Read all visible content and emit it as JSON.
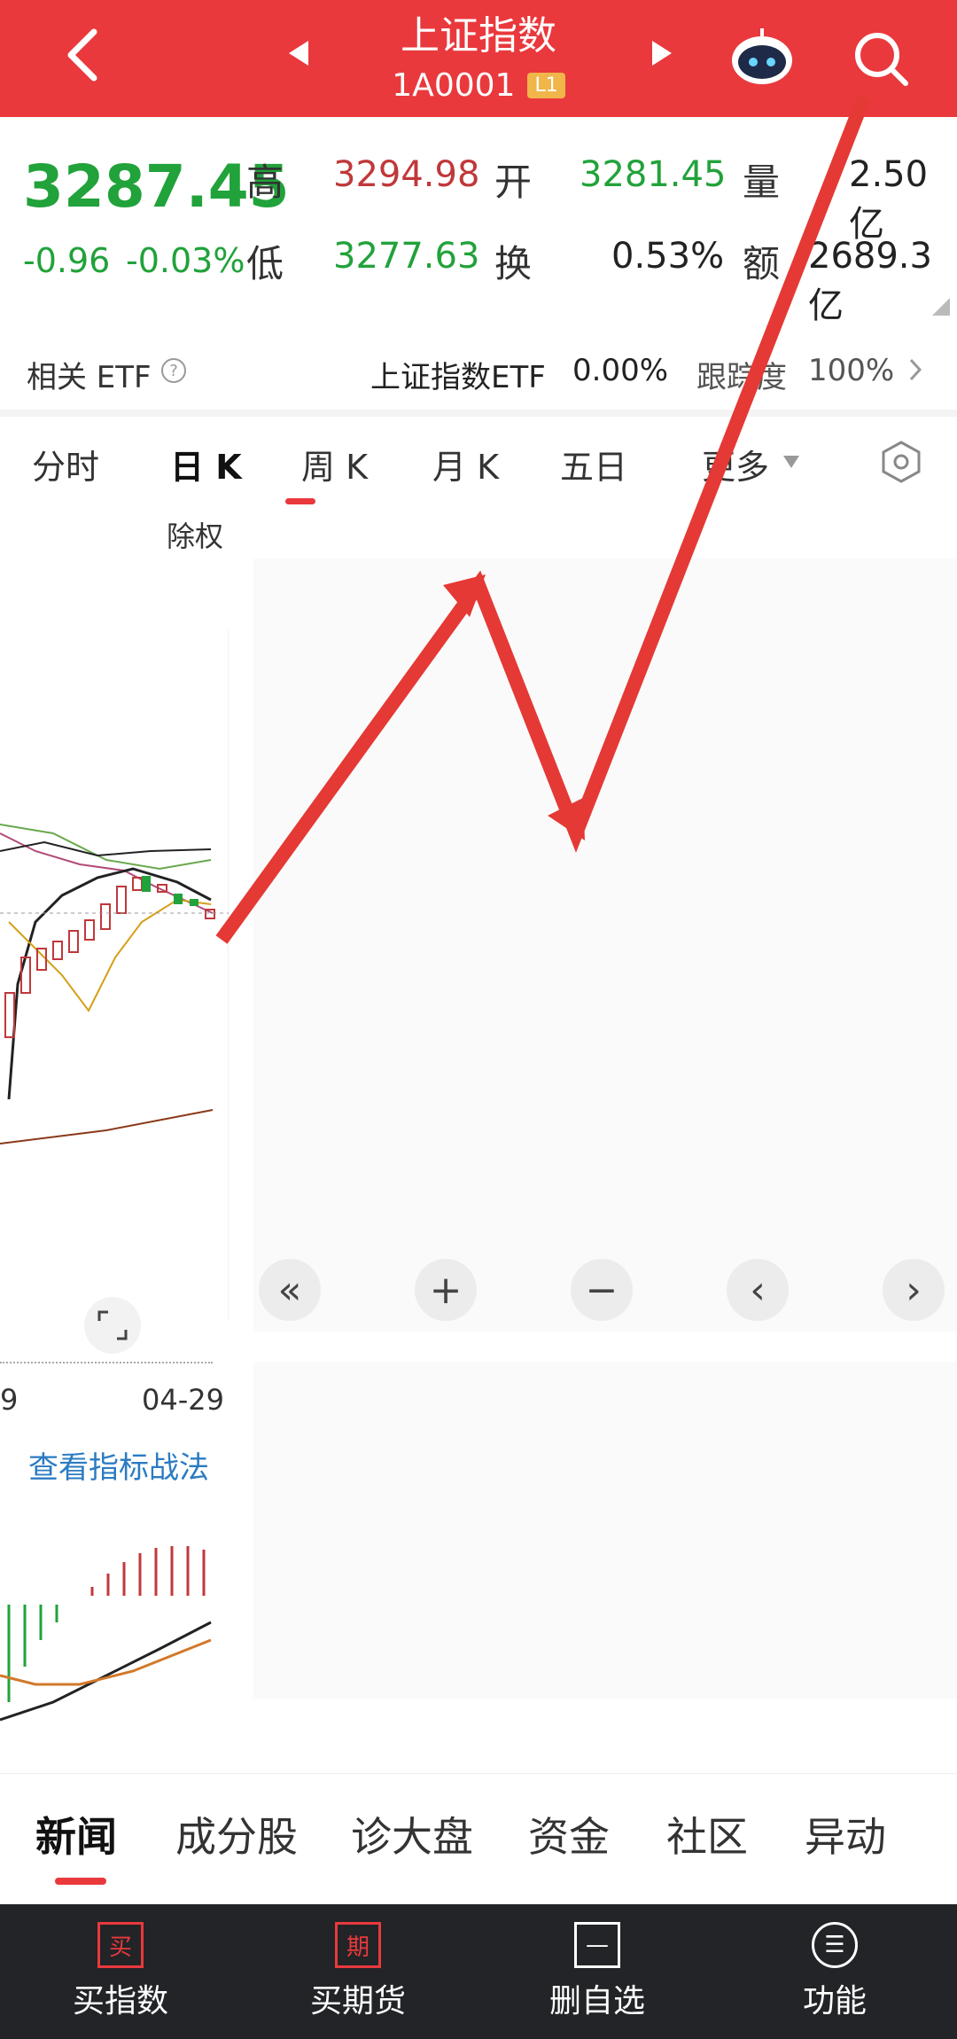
{
  "header": {
    "title": "上证指数",
    "code": "1A0001",
    "level": "L1"
  },
  "quote": {
    "price": "3287.45",
    "change": "-0.96",
    "change_pct": "-0.03%",
    "high_label": "高",
    "high": "3294.98",
    "open_label": "开",
    "open": "3281.45",
    "volume_label": "量",
    "volume": "2.50亿",
    "low_label": "低",
    "low": "3277.63",
    "turnover_label": "换",
    "turnover": "0.53%",
    "amount_label": "额",
    "amount": "2689.3亿"
  },
  "etf": {
    "label": "相关 ETF",
    "name": "上证指数ETF",
    "change": "0.00%",
    "tracking_label": "跟踪度",
    "tracking": "100%"
  },
  "tabs": [
    "分时",
    "日 K",
    "周 K",
    "月 K",
    "五日",
    "更多"
  ],
  "adjust_label": "除权",
  "axis": {
    "left_date": "9",
    "right_date": "04-29"
  },
  "indicator_link": "查看指标战法",
  "news_tabs": [
    "新闻",
    "成分股",
    "诊大盘",
    "资金",
    "社区",
    "异动"
  ],
  "bottom_bar": [
    {
      "label": "买指数",
      "icon_text": "买"
    },
    {
      "label": "买期货",
      "icon_text": "期"
    },
    {
      "label": "删自选",
      "icon_text": "—"
    },
    {
      "label": "功能",
      "icon_text": "☰"
    }
  ],
  "colors": {
    "header": "#e9393d",
    "rise": "#c0383a",
    "fall": "#21a23a",
    "arrow": "#e53935"
  }
}
